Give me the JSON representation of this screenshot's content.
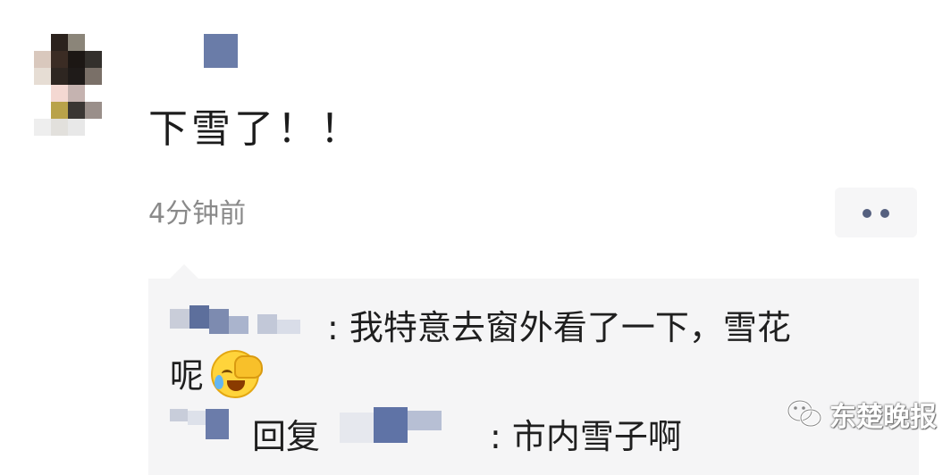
{
  "post": {
    "text": "下雪了！！",
    "time": "4分钟前"
  },
  "comments": [
    {
      "text_line1": ": 我特意去窗外看了一下，雪花",
      "text_line2": "呢",
      "emoji": "facepalm-crying-emoji"
    },
    {
      "reply_word": "回复",
      "text": ": 市内雪子啊"
    }
  ],
  "watermark": {
    "text": "东楚晚报",
    "icon": "wechat-icon"
  },
  "colors": {
    "comment_bg": "#f5f5f6",
    "more_dots": "#55607f",
    "time_text": "#8a8a8a"
  }
}
